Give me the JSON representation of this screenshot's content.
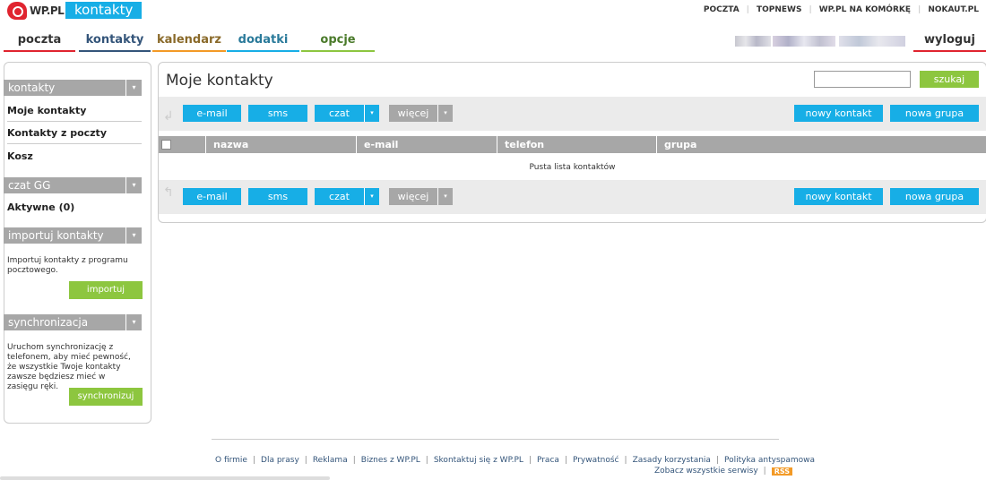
{
  "brand": {
    "logo_text": "WP.PL",
    "app_name": "kontakty"
  },
  "toplinks": [
    "POCZTA",
    "TOPNEWS",
    "WP.PL NA KOMÓRKĘ",
    "NOKAUT.PL"
  ],
  "nav": {
    "tabs": [
      {
        "label": "poczta",
        "color": "#e0242f"
      },
      {
        "label": "kontakty",
        "color": "#34557a"
      },
      {
        "label": "kalendarz",
        "color": "#f39a26"
      },
      {
        "label": "dodatki",
        "color": "#17aee6"
      },
      {
        "label": "opcje",
        "color": "#8dc63f"
      }
    ],
    "logout": "wyloguj"
  },
  "sidebar": {
    "contacts_header": "kontakty",
    "contacts_items": [
      "Moje kontakty",
      "Kontakty z poczty",
      "Kosz"
    ],
    "chat_header": "czat GG",
    "chat_active_label": "Aktywne",
    "chat_active_count": "(0)",
    "import_header": "importuj kontakty",
    "import_text": "Importuj kontakty z programu pocztowego.",
    "import_button": "importuj",
    "sync_header": "synchronizacja",
    "sync_text": "Uruchom synchronizację z telefonem, aby mieć pewność, że wszystkie Twoje kontakty zawsze będziesz mieć w zasięgu ręki.",
    "sync_button": "synchronizuj"
  },
  "main": {
    "title": "Moje kontakty",
    "search_value": "",
    "search_button": "szukaj",
    "toolbar": {
      "email": "e-mail",
      "sms": "sms",
      "chat": "czat",
      "more": "więcej",
      "new_contact": "nowy kontakt",
      "new_group": "nowa grupa"
    },
    "columns": [
      "nazwa",
      "e-mail",
      "telefon",
      "grupa"
    ],
    "empty_message": "Pusta lista kontaktów"
  },
  "footer": {
    "links": [
      "O firmie",
      "Dla prasy",
      "Reklama",
      "Biznes z WP.PL",
      "Skontaktuj się z WP.PL",
      "Praca",
      "Prywatność",
      "Zasady korzystania",
      "Polityka antyspamowa"
    ],
    "all_services": "Zobacz wszystkie serwisy",
    "rss": "RSS"
  },
  "colors": {
    "accent_blue": "#17aee6",
    "accent_green": "#8dc63f",
    "header_gray": "#a7a7a7",
    "brand_red": "#e0242f"
  }
}
